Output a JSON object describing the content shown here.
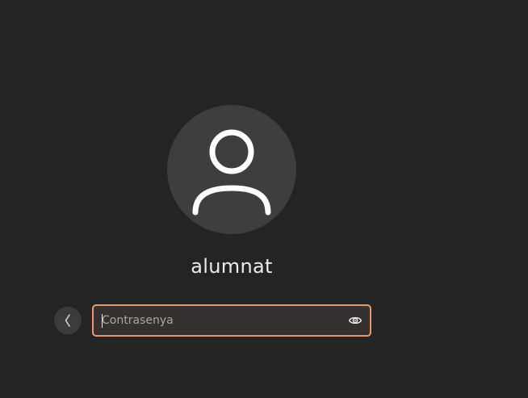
{
  "user": {
    "name": "alumnat",
    "avatar_icon": "user-silhouette-icon"
  },
  "login": {
    "password_placeholder": "Contrasenya",
    "password_value": "",
    "back_icon": "chevron-left-icon",
    "reveal_icon": "eye-icon"
  },
  "colors": {
    "background": "#242424",
    "avatar_background": "#3f3e3d",
    "focus_border": "#e9976b",
    "text": "#ececec"
  }
}
